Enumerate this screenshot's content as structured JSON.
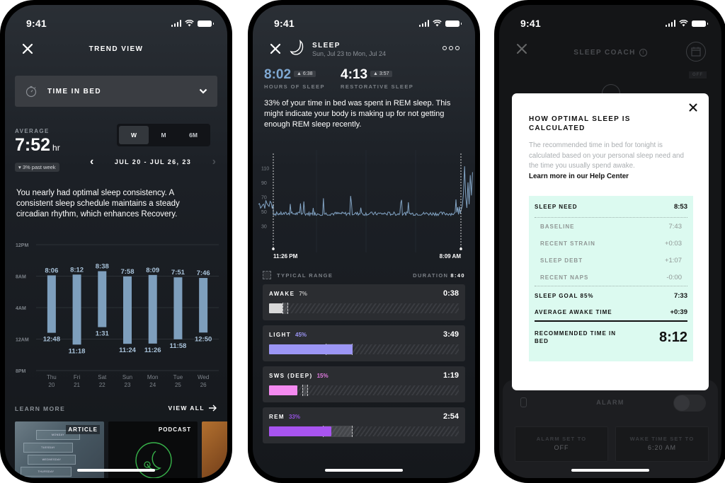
{
  "status_bar": {
    "time": "9:41"
  },
  "trend_view": {
    "title": "TREND VIEW",
    "metric": {
      "label": "TIME IN BED",
      "icon": "stopwatch-icon"
    },
    "average": {
      "label": "AVERAGE",
      "value": "7:52",
      "unit": "hr",
      "change": "3% past week",
      "change_direction": "down"
    },
    "range_tabs": [
      {
        "label": "W",
        "active": true
      },
      {
        "label": "M",
        "active": false
      },
      {
        "label": "6M",
        "active": false
      }
    ],
    "date_range": "JUL 20 - JUL 26, 23",
    "insight": "You nearly had optimal sleep consistency. A consistent sleep schedule maintains a steady circadian rhythm, which enhances Recovery.",
    "learn_more_label": "LEARN MORE",
    "view_all_label": "VIEW ALL",
    "cards": [
      {
        "tag": "ARTICLE",
        "days": [
          "MONDAY",
          "TUESDAY",
          "WEDNESDAY",
          "THURSDAY"
        ]
      },
      {
        "tag": "PODCAST"
      },
      {
        "tag": ""
      }
    ]
  },
  "chart_data": [
    {
      "type": "bar",
      "title": "Time in Bed (floating bars: bedtime to wake time)",
      "y_ticks": [
        "12PM",
        "8AM",
        "4AM",
        "12AM",
        "8PM"
      ],
      "ylim_hours_from_8pm": [
        0,
        16
      ],
      "categories": [
        "Thu 20",
        "Fri 21",
        "Sat 22",
        "Sun 23",
        "Mon 24",
        "Tue 25",
        "Wed 26"
      ],
      "day_labels": [
        "Thu",
        "Fri",
        "Sat",
        "Sun",
        "Mon",
        "Tue",
        "Wed"
      ],
      "date_labels": [
        "20",
        "21",
        "22",
        "23",
        "24",
        "25",
        "26"
      ],
      "bedtime": [
        "12:48",
        "11:18",
        "1:31",
        "11:24",
        "11:26",
        "11:58",
        "12:50"
      ],
      "waketime": [
        "8:06",
        "8:12",
        "8:38",
        "7:58",
        "8:09",
        "7:51",
        "7:46"
      ],
      "bedtime_hours_from_8pm": [
        4.8,
        3.3,
        5.52,
        3.4,
        3.43,
        3.97,
        4.83
      ],
      "waketime_hours_from_8pm": [
        12.1,
        12.2,
        12.63,
        11.97,
        12.15,
        11.85,
        11.77
      ],
      "bar_color": "#7e9fbd",
      "grid": true
    },
    {
      "type": "line",
      "title": "Heart rate during sleep",
      "y_ticks": [
        "110",
        "90",
        "70",
        "50",
        "30"
      ],
      "ylim": [
        20,
        120
      ],
      "start_label": "11:26 PM",
      "end_label": "8:09 AM",
      "baseline_bpm": 47,
      "pre_sleep_bpm": 60,
      "post_wake_peak_bpm": 115,
      "line_color": "#8eb3d6"
    }
  ],
  "sleep": {
    "title": "SLEEP",
    "subtitle": "Sun, Jul 23 to Mon, Jul 24",
    "hours_of_sleep": {
      "value": "8:02",
      "badge": "6:38",
      "label": "HOURS OF SLEEP",
      "color": "#7fa8d2"
    },
    "restorative_sleep": {
      "value": "4:13",
      "badge": "3:57",
      "label": "RESTORATIVE SLEEP"
    },
    "insight": "33% of your time in bed was spent in REM sleep. This might indicate your body is making up for not getting enough REM sleep recently.",
    "typical_range_label": "TYPICAL RANGE",
    "duration_label": "DURATION",
    "duration_value": "8:40",
    "stages": [
      {
        "name": "AWAKE",
        "pct": "7%",
        "time": "0:38",
        "fill": 0.07,
        "typical": [
          0.07,
          0.1
        ],
        "color": "#d9d9d9",
        "pct_color": "#bbbbbb"
      },
      {
        "name": "LIGHT",
        "pct": "45%",
        "time": "3:49",
        "fill": 0.44,
        "typical": [
          0.3,
          0.44
        ],
        "color": "#9c96f5",
        "pct_color": "#9c96f5"
      },
      {
        "name": "SWS (DEEP)",
        "pct": "15%",
        "time": "1:19",
        "fill": 0.15,
        "typical": [
          0.175,
          0.205
        ],
        "color": "#f48af0",
        "pct_color": "#e07ae0"
      },
      {
        "name": "REM",
        "pct": "33%",
        "time": "2:54",
        "fill": 0.33,
        "typical": [
          0.285,
          0.44
        ],
        "color": "#a854f0",
        "pct_color": "#9552e0"
      }
    ]
  },
  "sleep_coach": {
    "title": "SLEEP COACH",
    "off_label": "OFF",
    "modal": {
      "heading": "HOW OPTIMAL SLEEP IS CALCULATED",
      "description": "The recommended time in bed for tonight is calculated based on your personal sleep need and the time you usually spend awake.",
      "link": "Learn more in our Help Center",
      "sleep_need": {
        "label": "SLEEP NEED",
        "value": "8:53"
      },
      "components": [
        {
          "label": "BASELINE",
          "value": "7:43"
        },
        {
          "label": "RECENT STRAIN",
          "value": "+0:03"
        },
        {
          "label": "SLEEP DEBT",
          "value": "+1:07"
        },
        {
          "label": "RECENT NAPS",
          "value": "-0:00"
        }
      ],
      "sleep_goal": {
        "label": "SLEEP GOAL 85%",
        "value": "7:33"
      },
      "awake_time": {
        "label": "AVERAGE AWAKE TIME",
        "value": "+0:39"
      },
      "recommended": {
        "label": "RECOMMENDED TIME IN BED",
        "value": "8:12"
      },
      "panel_color": "#dcfaf0"
    },
    "alarm": {
      "title": "ALARM",
      "enabled": false,
      "alarm_set_label": "ALARM SET TO",
      "alarm_set_value": "OFF",
      "wake_time_label": "WAKE TIME SET TO",
      "wake_time_value": "6:20 AM"
    }
  }
}
